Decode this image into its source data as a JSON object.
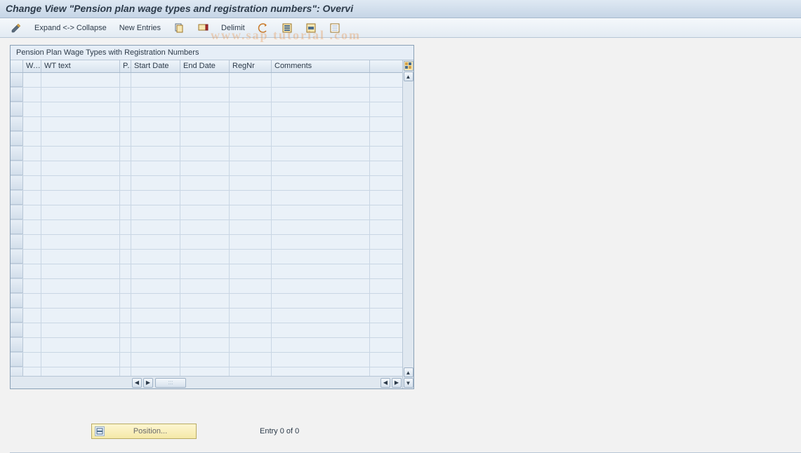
{
  "title": "Change View \"Pension plan wage types and registration numbers\": Overvi",
  "toolbar": {
    "expand_collapse_label": "Expand <-> Collapse",
    "new_entries_label": "New Entries",
    "delimit_label": "Delimit"
  },
  "pencil_icon": "pencil-icon",
  "copy_icon": "copy-icon",
  "delete_icon": "delete-icon",
  "undo_icon": "undo-icon",
  "selectall_icon": "select-all-icon",
  "selectblock_icon": "select-block-icon",
  "deselect_icon": "deselect-icon",
  "watermark_text": "www.sap tutorial .com",
  "panel": {
    "title": "Pension Plan Wage Types with Registration Numbers",
    "columns": {
      "w": "W...",
      "wt_text": "WT text",
      "p": "P..",
      "start_date": "Start Date",
      "end_date": "End Date",
      "regnr": "RegNr",
      "comments": "Comments"
    },
    "rows": []
  },
  "table_config_icon": "table-config-icon",
  "position_button_label": "Position...",
  "entry_status": "Entry 0 of 0"
}
